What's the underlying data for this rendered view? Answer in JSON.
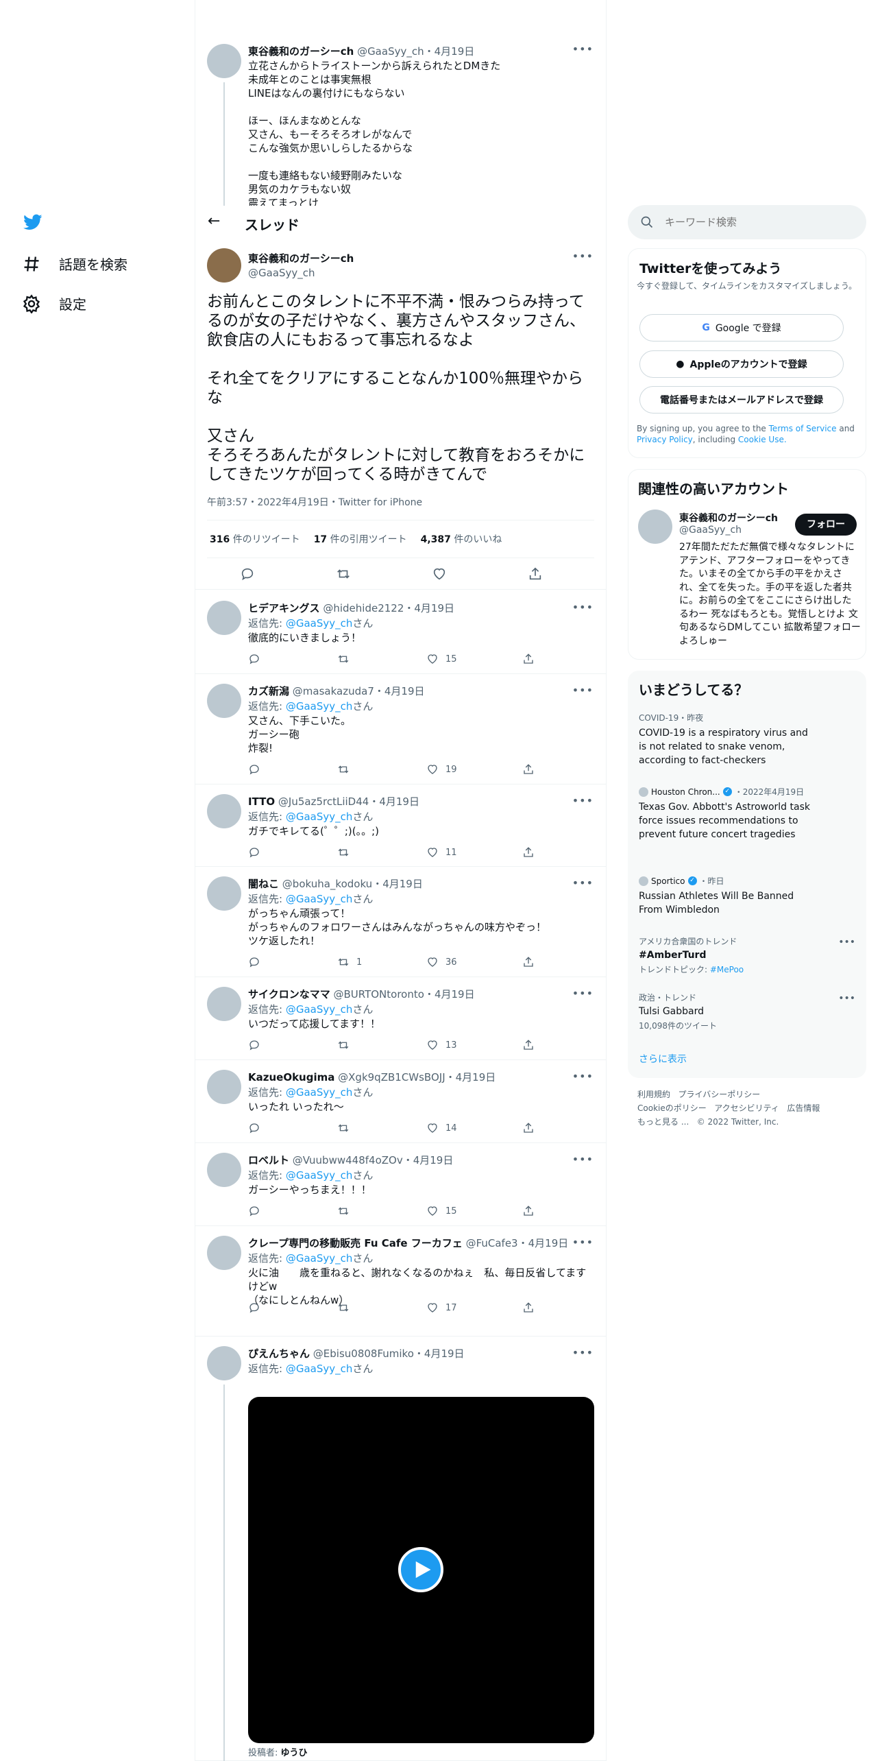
{
  "nav": {
    "explore_label": "話題を検索",
    "settings_label": "設定"
  },
  "header": {
    "title": "スレッド"
  },
  "search": {
    "placeholder": "キーワード検索"
  },
  "prev_tweet": {
    "name": "東谷義和のガーシーch",
    "handle": "@GaaSyy_ch",
    "date": "4月19日",
    "text": "立花さんからトライストーンから訴えられたとDMきた\n未成年とのことは事実無根\nLINEはなんの裏付けにもならない\n\nほー、ほんまなめとんな\n又さん、もーそろそろオレがなんで\nこんな強気か思いしらしたるからな\n\n一度も連絡もない綾野剛みたいな\n男気のカケラもない奴\n震えてまっとけ"
  },
  "main_tweet": {
    "name": "東谷義和のガーシーch",
    "handle": "@GaaSyy_ch",
    "text": "お前んとこのタレントに不平不満・恨みつらみ持ってるのが女の子だけやなく、裏方さんやスタッフさん、飲食店の人にもおるって事忘れるなよ\n\nそれ全てをクリアにすることなんか100％無理やからな\n\n又さん\nそろそろあんたがタレントに対して教育をおろそかにしてきたツケが回ってくる時がきてんで",
    "meta": "午前3:57・2022年4月19日・Twitter for iPhone",
    "retweets": "316",
    "retweets_label": "件のリツイート",
    "quotes": "17",
    "quotes_label": "件の引用ツイート",
    "likes": "4,387",
    "likes_label": "件のいいね"
  },
  "reply_prefix": "返信先: ",
  "reply_to": "@GaaSyy_ch",
  "reply_suffix": "さん",
  "replies": [
    {
      "name": "ヒデアキングス",
      "handle": "@hidehide2122",
      "date": "4月19日",
      "text": "徹底的にいきましょう！",
      "retweets": "",
      "likes": "15"
    },
    {
      "name": "カズ新潟",
      "handle": "@masakazuda7",
      "date": "4月19日",
      "text": "又さん、下手こいた。\nガーシー砲\n炸裂!",
      "retweets": "",
      "likes": "19"
    },
    {
      "name": "ITTO",
      "handle": "@Ju5az5rctLiiD44",
      "date": "4月19日",
      "text": "ガチでキレてる(゜゜;)(。。;)",
      "retweets": "",
      "likes": "11"
    },
    {
      "name": "闇ねこ",
      "handle": "@bokuha_kodoku",
      "date": "4月19日",
      "text": "がっちゃん頑張って！\nがっちゃんのフォロワーさんはみんながっちゃんの味方やぞっ！\nツケ返したれ！",
      "retweets": "1",
      "likes": "36"
    },
    {
      "name": "サイクロンなママ",
      "handle": "@BURTONtoronto",
      "date": "4月19日",
      "text": "いつだって応援してます！！",
      "retweets": "",
      "likes": "13"
    },
    {
      "name": "KazueOkugima",
      "handle": "@Xgk9qZB1CWsBOJJ",
      "date": "4月19日",
      "text": "いったれ いったれ～",
      "retweets": "",
      "likes": "14"
    },
    {
      "name": "ロベルト",
      "handle": "@Vuubww448f4oZOv",
      "date": "4月19日",
      "text": "ガーシーやっちまえ！！！",
      "retweets": "",
      "likes": "15"
    },
    {
      "name": "クレープ専門の移動販売 Fu Cafe フーカフェ",
      "handle": "@FuCafe3",
      "date": "4月19日",
      "text": "火に油　　歳を重ねると、謝れなくなるのかねぇ　私、毎日反省してますけどw\n（なにしとんねんw）",
      "retweets": "",
      "likes": "17"
    },
    {
      "name": "ぴえんちゃん",
      "handle": "@Ebisu0808Fumiko",
      "date": "4月19日",
      "text": "",
      "retweets": "",
      "likes": ""
    }
  ],
  "video": {
    "poster_label": "投稿者:",
    "poster_name": "ゆうひ"
  },
  "signup": {
    "title": "Twitterを使ってみよう",
    "subtitle": "今すぐ登録して、タイムラインをカスタマイズしましょう。",
    "google_label": "Google で登録",
    "apple_label": "Appleのアカウントで登録",
    "phone_label": "電話番号またはメールアドレスで登録",
    "terms_prefix": "By signing up, you agree to the ",
    "terms_link": "Terms of Service",
    "terms_and": " and ",
    "privacy_link": "Privacy Policy",
    "terms_including": ", including ",
    "cookie_link": "Cookie Use."
  },
  "related": {
    "title": "関連性の高いアカウント",
    "name": "東谷義和のガーシーch",
    "handle": "@GaaSyy_ch",
    "follow_label": "フォロー",
    "bio": "27年間ただただ無償で様々なタレントにアテンド、アフターフォローをやってきた。いまその全てから手の平をかえされ、全てを失った。手の平を返した者共に。お前らの全てをここにさらけ出したるわー 死なばもろとも。覚悟しとけよ 文句あるならDMしてこい 拡散希望フォローよろしゅー"
  },
  "trends": {
    "title": "いまどうしてる？",
    "items": [
      {
        "meta": "COVID-19・昨夜",
        "headline": "COVID-19 is a respiratory virus and is not related to snake venom, according to fact-checkers"
      },
      {
        "source": "Houston Chron...",
        "date": "・2022年4月19日",
        "headline": "Texas Gov. Abbott's Astroworld task force issues recommendations to prevent future concert tragedies"
      },
      {
        "source": "Sportico",
        "date": "・昨日",
        "headline": "Russian Athletes Will Be Banned From Wimbledon"
      },
      {
        "meta": "アメリカ合衆国のトレンド",
        "headline": "#AmberTurd",
        "topic_prefix": "トレンドトピック: ",
        "topic_link": "#MePoo"
      },
      {
        "meta": "政治・トレンド",
        "headline": "Tulsi Gabbard",
        "count": "10,098件のツイート"
      }
    ],
    "show_more": "さらに表示"
  },
  "footer": {
    "links": [
      "利用規約",
      "プライバシーポリシー",
      "Cookieのポリシー",
      "アクセシビリティ",
      "広告情報",
      "もっと見る ..."
    ],
    "copyright": "© 2022 Twitter, Inc."
  }
}
